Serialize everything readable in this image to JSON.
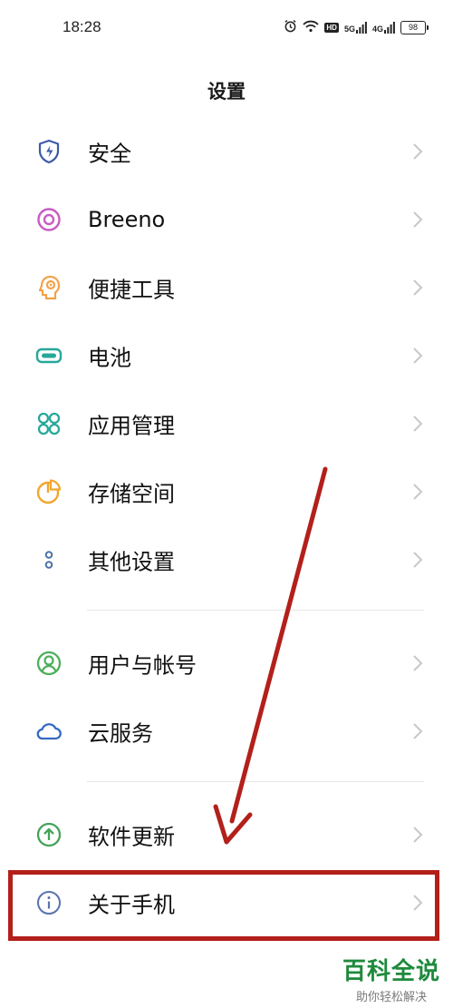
{
  "status_bar": {
    "time": "18:28",
    "signal_1": "5G",
    "signal_2": "4G",
    "hd": "HD",
    "battery": "98"
  },
  "header": {
    "title": "设置"
  },
  "items": [
    {
      "label": "安全",
      "icon": "shield-icon",
      "color": "#3d5aa8"
    },
    {
      "label": "Breeno",
      "icon": "breeno-icon",
      "color": "#c85cc4"
    },
    {
      "label": "便捷工具",
      "icon": "head-tools-icon",
      "color": "#f2a24a"
    },
    {
      "label": "电池",
      "icon": "battery-icon",
      "color": "#26a89a"
    },
    {
      "label": "应用管理",
      "icon": "app-grid-icon",
      "color": "#27a99b"
    },
    {
      "label": "存储空间",
      "icon": "pie-storage-icon",
      "color": "#f2a62e"
    },
    {
      "label": "其他设置",
      "icon": "dots-icon",
      "color": "#4d6fa6"
    },
    {
      "label": "用户与帐号",
      "icon": "user-icon",
      "color": "#4caf5a"
    },
    {
      "label": "云服务",
      "icon": "cloud-icon",
      "color": "#3569c4"
    },
    {
      "label": "软件更新",
      "icon": "upgrade-icon",
      "color": "#45a35a"
    },
    {
      "label": "关于手机",
      "icon": "info-icon",
      "color": "#5873ad"
    }
  ],
  "colors": {
    "annotation_red": "#b3201a",
    "watermark_green": "#1e8a3c"
  },
  "watermark": {
    "title": "百科全说",
    "subtitle": "助你轻松解决"
  }
}
